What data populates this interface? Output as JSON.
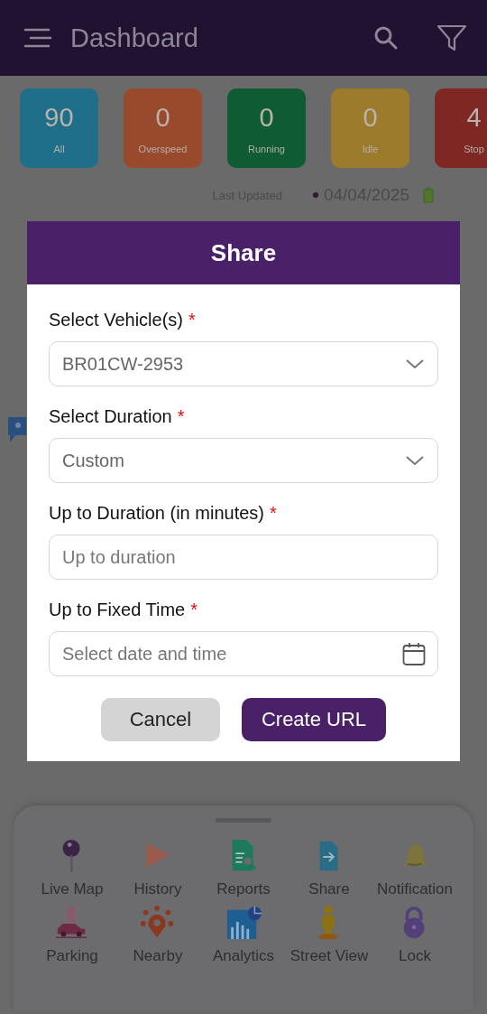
{
  "header": {
    "title": "Dashboard"
  },
  "tiles": [
    {
      "count": "90",
      "label": "All",
      "color": "#1f6f8b"
    },
    {
      "count": "0",
      "label": "Overspeed",
      "color": "#9a4a2c"
    },
    {
      "count": "0",
      "label": "Running",
      "color": "#0f5b33"
    },
    {
      "count": "0",
      "label": "Idle",
      "color": "#9c7b2c"
    },
    {
      "count": "4",
      "label": "Stop",
      "color": "#7f2723"
    }
  ],
  "last_updated": {
    "label": "Last Updated",
    "value": "04/04/2025"
  },
  "dialog": {
    "title": "Share",
    "fields": [
      {
        "kind": "select",
        "label": "Select Vehicle(s)",
        "required_mark": "*",
        "value": "BR01CW-2953"
      },
      {
        "kind": "select",
        "label": "Select Duration",
        "required_mark": "*",
        "value": "Custom"
      },
      {
        "kind": "input",
        "label": "Up to Duration (in minutes)",
        "required_mark": "*",
        "placeholder": "Up to duration"
      },
      {
        "kind": "datetime",
        "label": "Up to Fixed Time",
        "required_mark": "*",
        "placeholder": "Select date and time"
      }
    ],
    "buttons": [
      {
        "kind": "secondary",
        "label": "Cancel"
      },
      {
        "kind": "primary",
        "label": "Create URL"
      }
    ]
  },
  "menu": [
    {
      "kind": "pin",
      "label": "Live Map"
    },
    {
      "kind": "play",
      "label": "History"
    },
    {
      "kind": "report",
      "label": "Reports"
    },
    {
      "kind": "share",
      "label": "Share"
    },
    {
      "kind": "bell",
      "label": "Notification"
    },
    {
      "kind": "parking",
      "label": "Parking"
    },
    {
      "kind": "nearby",
      "label": "Nearby"
    },
    {
      "kind": "analytics",
      "label": "Analytics"
    },
    {
      "kind": "person",
      "label": "Street View"
    },
    {
      "kind": "lock",
      "label": "Lock"
    }
  ]
}
